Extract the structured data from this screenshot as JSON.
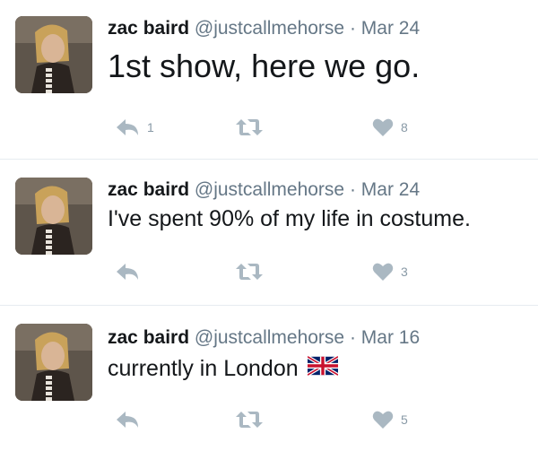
{
  "tweets": [
    {
      "name": "zac baird",
      "handle": "@justcallmehorse",
      "separator": "·",
      "date": "Mar 24",
      "text": "1st show, here we go.",
      "reply_count": "1",
      "retweet_count": "",
      "like_count": "8"
    },
    {
      "name": "zac baird",
      "handle": "@justcallmehorse",
      "separator": "·",
      "date": "Mar 24",
      "text": "I've spent 90% of my life in costume.",
      "reply_count": "",
      "retweet_count": "",
      "like_count": "3"
    },
    {
      "name": "zac baird",
      "handle": "@justcallmehorse",
      "separator": "·",
      "date": "Mar 16",
      "text": "currently in London",
      "emoji": "uk-flag-emoji",
      "reply_count": "",
      "retweet_count": "",
      "like_count": "5"
    }
  ],
  "colors": {
    "action_icon": "#aab8c2",
    "meta_text": "#657786",
    "separator": "#e6ecf0"
  },
  "icons": [
    "reply-icon",
    "retweet-icon",
    "heart-icon"
  ]
}
